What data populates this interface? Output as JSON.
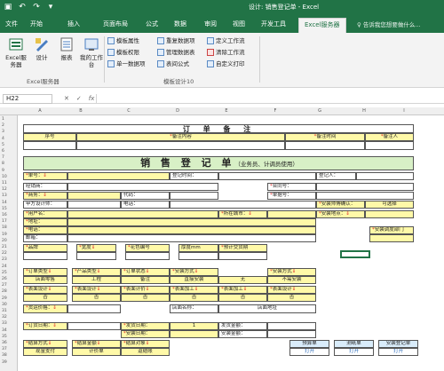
{
  "window": {
    "title": "设计: 销售登记单 - Excel"
  },
  "qat": {
    "save_icon": "save-icon",
    "undo": "↶",
    "redo": "↷"
  },
  "tabs": [
    "文件",
    "开始",
    "插入",
    "页面布局",
    "公式",
    "数据",
    "审阅",
    "视图",
    "开发工具",
    "Excel服务器"
  ],
  "tell_me": "♀ 告诉我您想要做什么...",
  "ribbon": {
    "groups": [
      {
        "label": "Excel服务器",
        "buttons": [
          "Excel服务器",
          "设计",
          "报表",
          "我的工作台"
        ]
      },
      {
        "label": "模板设计10",
        "items": [
          "模板属性",
          "重复数据项",
          "定义工作流",
          "模板权限",
          "管理数据表",
          "清除工作流",
          "单一数据项",
          "表间公式",
          "自定义打印"
        ]
      }
    ]
  },
  "formula_bar": {
    "name_box": "H22",
    "cancel": "✕",
    "enter": "✓",
    "fx": "fx",
    "value": ""
  },
  "columns": [
    "A",
    "B",
    "C",
    "D",
    "E",
    "F",
    "G",
    "H",
    "I"
  ],
  "rows": [
    "1",
    "2",
    "3",
    "4",
    "5",
    "6",
    "7",
    "8",
    "9",
    "10",
    "11",
    "12",
    "13",
    "14",
    "15",
    "16",
    "17",
    "18",
    "19",
    "20",
    "21",
    "22",
    "23",
    "24",
    "25",
    "26",
    "27",
    "28",
    "29",
    "30",
    "31",
    "32",
    "33",
    "34",
    "35",
    "36",
    "37",
    "38",
    "39"
  ],
  "sheet": {
    "order_title": "订 单 备 注",
    "order_hdr": [
      "序号",
      "备注内容",
      "备注时间",
      "备注人"
    ],
    "main_title": "销 售 登 记 单",
    "main_sub": "（业务员、计调员使用）",
    "f": {
      "r1a": "单号：",
      "r1b": "登记时间：",
      "r1c": "登记人：",
      "r2a": "经销商：",
      "r2b": "合同号：",
      "r3a": "商务：",
      "r3b": "代码：",
      "r3c": "单据号：",
      "r4a": "甲方设计师：",
      "r4b": "电话：",
      "r4c": "安装师傅确认：",
      "r4d": "可选择",
      "r5a": "用户名：",
      "r5b": "所在城市：",
      "r5c": "安装地点：",
      "r6a": "地址：",
      "r7a": "电话：",
      "r7b": "安装调度部门",
      "r8a": "邮箱：",
      "h1": [
        "品牌",
        "宽度",
        "花色编号",
        "厚度mm",
        "预计交货期"
      ],
      "h2": [
        "订单类型",
        "产品类型",
        "订单状态",
        "安装方式",
        "安装方式"
      ],
      "v2": [
        "店面零售",
        "工程",
        "备注",
        "直接安装",
        "无",
        "不需安装"
      ],
      "h3": [
        "表面设计",
        "表面设计",
        "表面计价",
        "表面加工",
        "表面加工",
        "表面设计"
      ],
      "v3": [
        "否",
        "否",
        "否",
        "否",
        "否",
        "否"
      ],
      "r9a": "货运价格：",
      "r9b": "店面名称：",
      "r9c": "店面地址",
      "r10a": "订货日期：",
      "r10b": "发货日期：",
      "r10c": "1",
      "r10d": "发货金额：",
      "r11b": "安装日期：",
      "r11d": "安装金额：",
      "r12h": [
        "结算方式",
        "结算金额",
        "结算对象",
        "预算单",
        "测纸单",
        "安装登记单"
      ],
      "r12v": [
        "现金支付",
        "计价单",
        "返结账",
        "打开",
        "打开",
        "打开"
      ]
    }
  }
}
